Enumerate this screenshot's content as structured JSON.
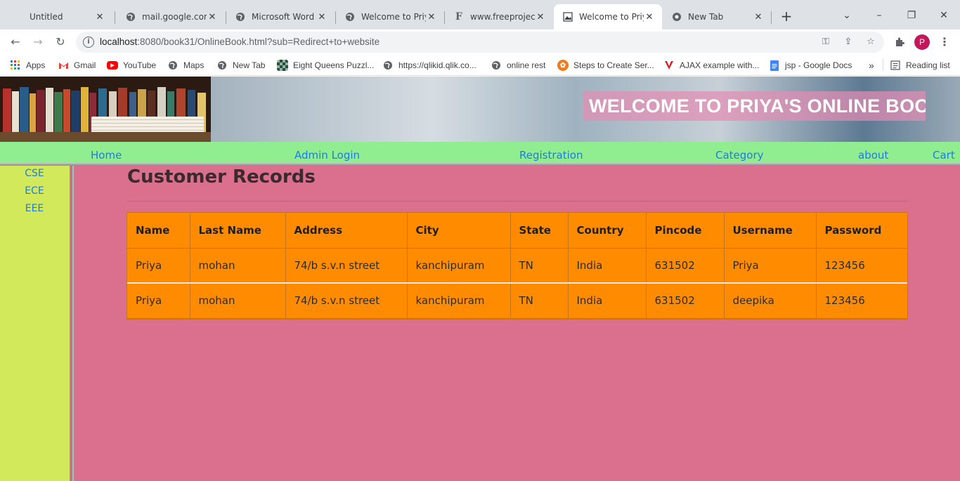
{
  "browser": {
    "tabs": [
      {
        "title": "Untitled",
        "favicon": "none",
        "active": false
      },
      {
        "title": "mail.google.com",
        "favicon": "globe-icon",
        "active": false
      },
      {
        "title": "Microsoft Word -",
        "favicon": "globe-icon",
        "active": false
      },
      {
        "title": "Welcome to Priya",
        "favicon": "globe-icon",
        "active": false
      },
      {
        "title": "www.freeproject",
        "favicon": "freeprojectz-icon",
        "active": false
      },
      {
        "title": "Welcome to Priya",
        "favicon": "page-image-icon",
        "active": true
      },
      {
        "title": "New Tab",
        "favicon": "chrome-icon",
        "active": false
      }
    ],
    "new_tab_symbol": "+",
    "window_controls": {
      "dropdown": "⌄",
      "minimize": "–",
      "restore": "❐",
      "close": "✕"
    },
    "nav": {
      "back": "←",
      "forward": "→",
      "reload": "↻"
    },
    "url": {
      "host": "localhost",
      "rest": ":8080/book31/OnlineBook.html?sub=Redirect+to+website"
    },
    "avatar_letter": "P",
    "bookmarks": [
      {
        "label": "Apps",
        "icon": "apps-grid-icon"
      },
      {
        "label": "Gmail",
        "icon": "gmail-icon"
      },
      {
        "label": "YouTube",
        "icon": "youtube-icon"
      },
      {
        "label": "Maps",
        "icon": "globe-icon"
      },
      {
        "label": "New Tab",
        "icon": "globe-icon"
      },
      {
        "label": "Eight Queens Puzzl...",
        "icon": "chessboard-icon"
      },
      {
        "label": "https://qlikid.qlik.co...",
        "icon": "globe-icon"
      },
      {
        "label": "online rest",
        "icon": "globe-icon"
      },
      {
        "label": "Steps to Create Ser...",
        "icon": "tutorial-icon"
      },
      {
        "label": "AJAX example with...",
        "icon": "v-icon"
      },
      {
        "label": "jsp - Google Docs",
        "icon": "docs-icon"
      }
    ],
    "bookmarks_overflow": "»",
    "reading_list": "Reading list"
  },
  "site": {
    "banner_title": "WELCOME TO PRIYA'S ONLINE BOOK",
    "nav": [
      "Home",
      "Admin Login",
      "Registration",
      "Category",
      "about",
      "Cart"
    ],
    "sidebar": [
      "CSE",
      "ECE",
      "EEE"
    ],
    "heading": "Customer Records",
    "table": {
      "columns": [
        "Name",
        "Last Name",
        "Address",
        "City",
        "State",
        "Country",
        "Pincode",
        "Username",
        "Password"
      ],
      "rows": [
        [
          "Priya",
          "mohan",
          "74/b s.v.n street",
          "kanchipuram",
          "TN",
          "India",
          "631502",
          "Priya",
          "123456"
        ],
        [
          "Priya",
          "mohan",
          "74/b s.v.n street",
          "kanchipuram",
          "TN",
          "India",
          "631502",
          "deepika",
          "123456"
        ]
      ]
    }
  },
  "colors": {
    "page_bg": "#db6f8e",
    "navbar_bg": "#90ee90",
    "sidebar_bg": "#d1e95a",
    "table_bg": "#ff8c00",
    "link": "#1e7be0"
  }
}
